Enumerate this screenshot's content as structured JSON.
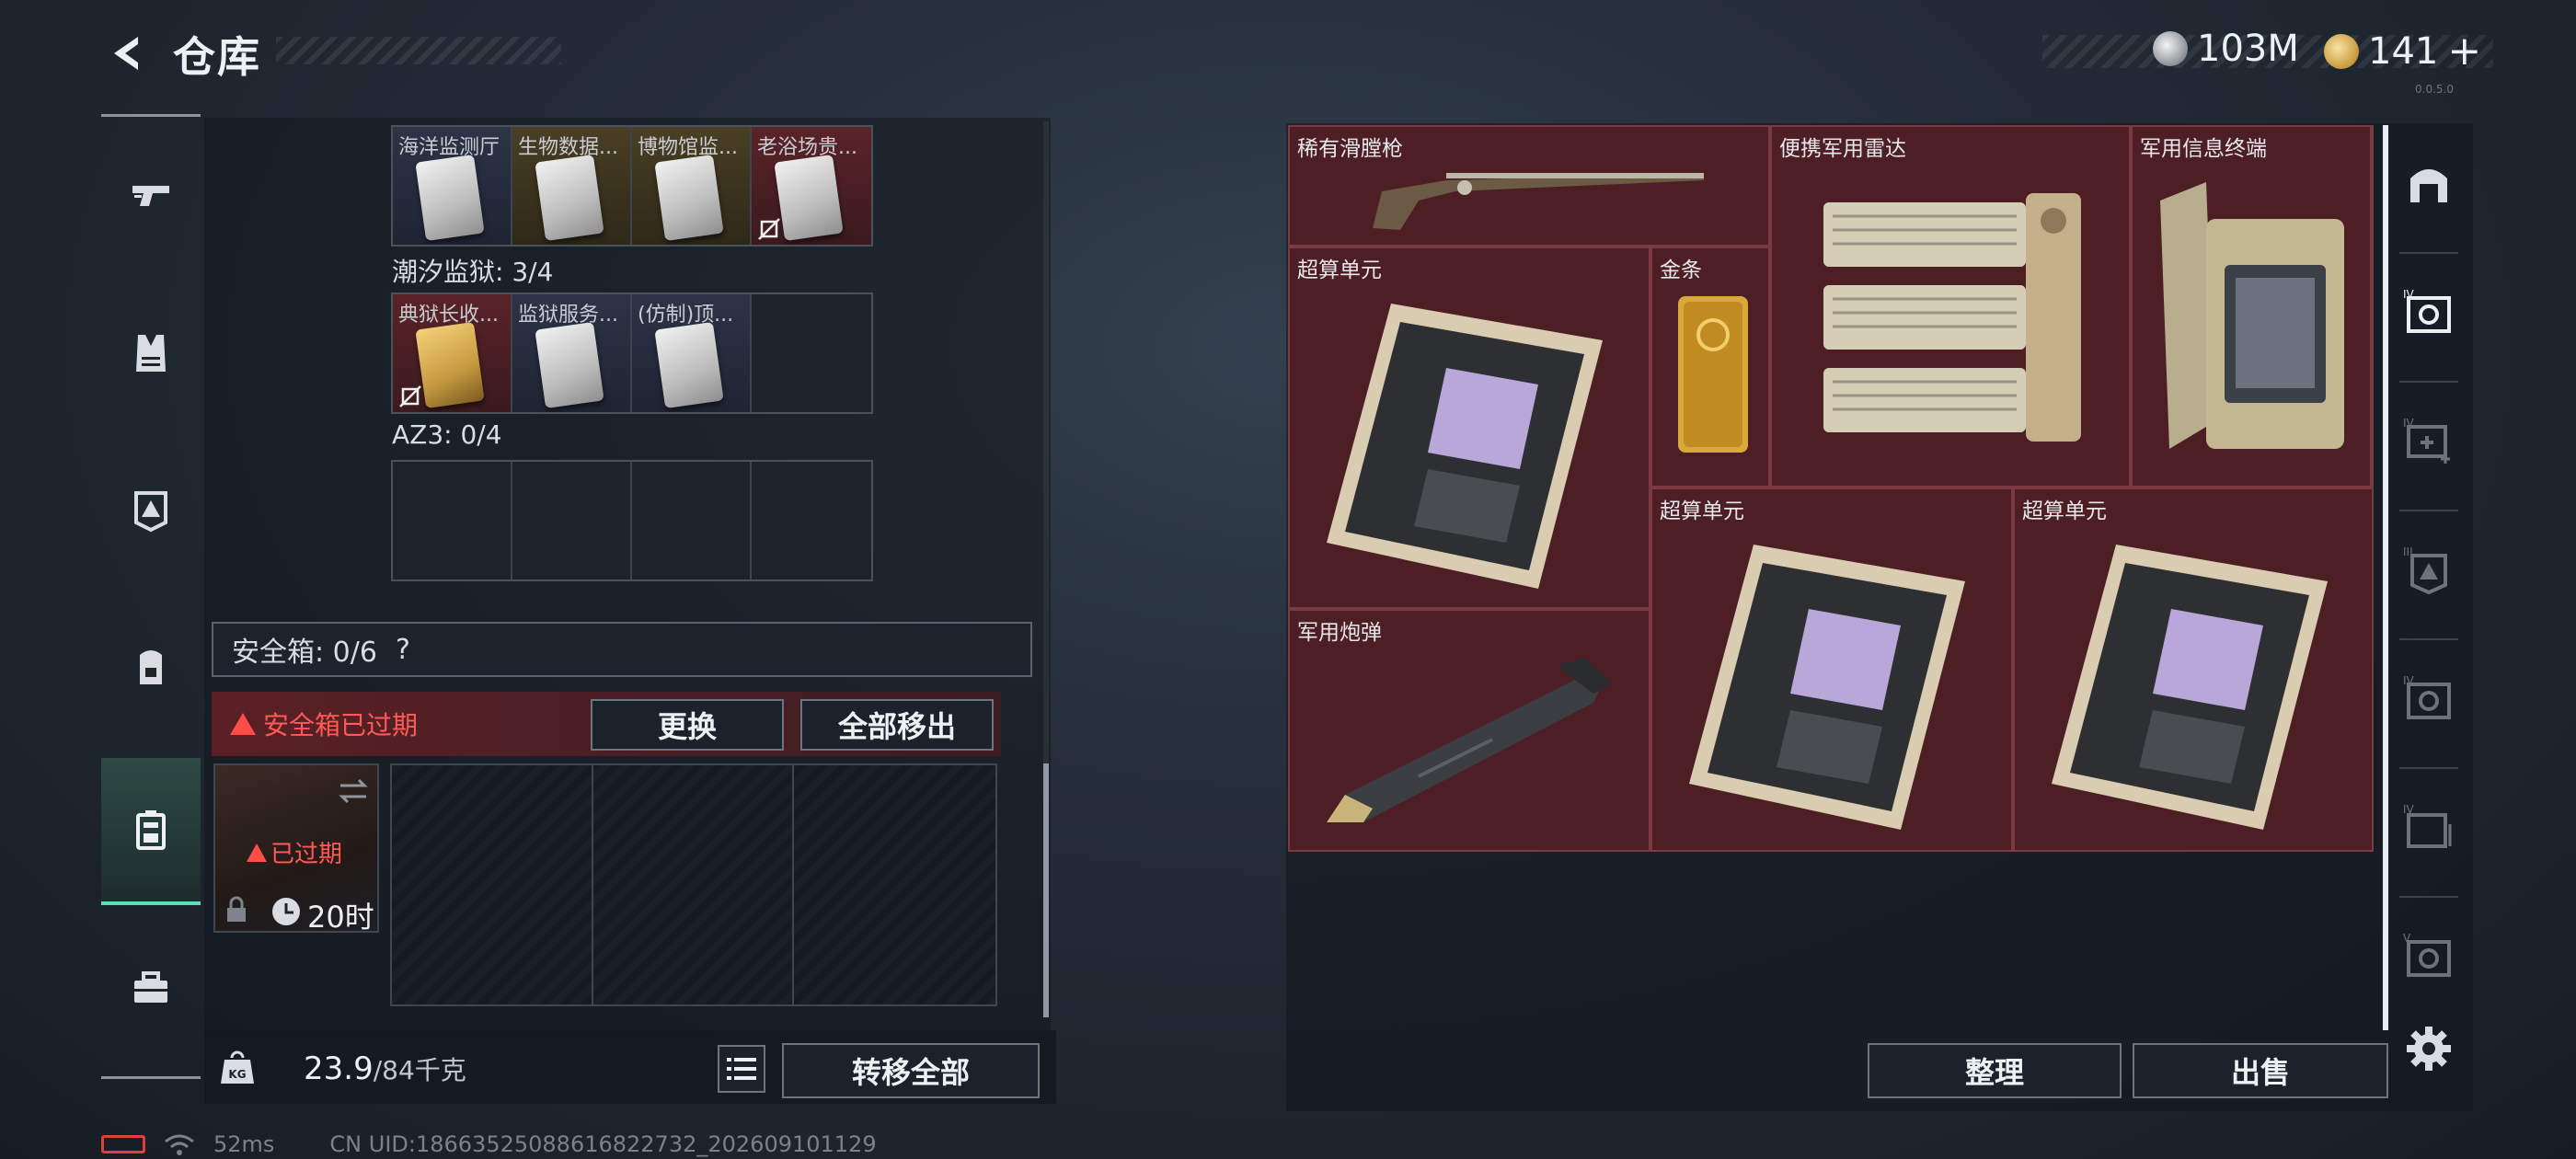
{
  "header": {
    "title": "仓库",
    "currency_silver": "103M",
    "currency_gold": "141",
    "gold_plus": "+",
    "version": "0.0.5.0"
  },
  "left_nav": {
    "items": [
      {
        "icon": "pistol-icon"
      },
      {
        "icon": "vest-icon"
      },
      {
        "icon": "helmet-icon"
      },
      {
        "icon": "backpack-icon"
      },
      {
        "icon": "safebox-icon",
        "active": true
      },
      {
        "icon": "toolbox-icon"
      }
    ]
  },
  "container": {
    "grid1": [
      {
        "label": "海洋监测厅",
        "rarity": "blue"
      },
      {
        "label": "生物数据...",
        "rarity": "gold"
      },
      {
        "label": "博物馆监...",
        "rarity": "gold"
      },
      {
        "label": "老浴场贵...",
        "rarity": "red",
        "unlinked": true
      }
    ],
    "section2_label": "潮汐监狱: 3/4",
    "grid2": [
      {
        "label": "典狱长收...",
        "rarity": "red",
        "unlinked": true,
        "gold_card": true
      },
      {
        "label": "监狱服务...",
        "rarity": "blue"
      },
      {
        "label": "(仿制)顶...",
        "rarity": "blue"
      },
      {
        "label": "",
        "rarity": "empty"
      }
    ],
    "section3_label": "AZ3: 0/4",
    "safe_label": "安全箱: 0/6",
    "safe_help": "?",
    "safe_alert": "安全箱已过期",
    "replace_btn": "更换",
    "move_all_out_btn": "全部移出",
    "safe_item_status": "已过期",
    "safe_item_timer": "20时",
    "weight_value": "23.9",
    "weight_max": "/84千克",
    "transfer_all_btn": "转移全部",
    "kg_label": "KG"
  },
  "stash": {
    "items": [
      {
        "label": "稀有滑膛枪"
      },
      {
        "label": "便携军用雷达"
      },
      {
        "label": "军用信息终端"
      },
      {
        "label": "超算单元"
      },
      {
        "label": "金条"
      },
      {
        "label": "超算单元"
      },
      {
        "label": "超算单元"
      },
      {
        "label": "军用炮弹"
      }
    ],
    "organize_btn": "整理",
    "sell_btn": "出售"
  },
  "right_nav": {
    "items": [
      {
        "icon": "arch-icon"
      },
      {
        "icon": "safe-iv-icon"
      },
      {
        "icon": "medkit-iv-icon"
      },
      {
        "icon": "helmet-iii-icon"
      },
      {
        "icon": "safe-iv-2-icon"
      },
      {
        "icon": "box-iv-icon"
      },
      {
        "icon": "safe-v-icon"
      },
      {
        "icon": "settings-gear-icon"
      }
    ]
  },
  "status_bar": {
    "ping": "52ms",
    "uid": "CN UID:18663525088616822732_202609101129"
  }
}
